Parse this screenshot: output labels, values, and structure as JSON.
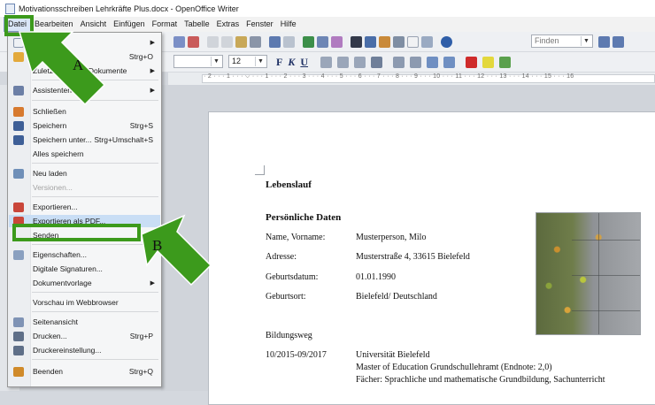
{
  "window": {
    "title": "Motivationsschreiben Lehrkräfte Plus.docx - OpenOffice Writer"
  },
  "menubar": [
    "Datei",
    "Bearbeiten",
    "Ansicht",
    "Einfügen",
    "Format",
    "Tabelle",
    "Extras",
    "Fenster",
    "Hilfe"
  ],
  "toolbar": {
    "search_placeholder": "Finden",
    "font_size": "12",
    "bold": "F",
    "italic": "K",
    "underline": "U"
  },
  "ruler": {
    "ticks": "· 2 · · · 1 · · · ⌵ · · · 1 · · · 2 · · · 3 · · · 4 · · · 5 · · · 6 · · · 7 · · · 8 · · · 9 · · · 10 · · · 11 · · · 12 · · · 13 · · · 14 · · · 15 · · · 16"
  },
  "file_menu": {
    "items": [
      {
        "label": "N",
        "shortcut": "",
        "submenu": true
      },
      {
        "label": "Öffnen...",
        "shortcut": "Strg+O"
      },
      {
        "label": "Zuletzt benutzte Dokumente",
        "shortcut": "",
        "submenu": true
      },
      {
        "label": "Assistenten",
        "shortcut": "",
        "submenu": true
      },
      {
        "label": "Schließen",
        "shortcut": ""
      },
      {
        "label": "Speichern",
        "shortcut": "Strg+S"
      },
      {
        "label": "Speichern unter...",
        "shortcut": "Strg+Umschalt+S"
      },
      {
        "label": "Alles speichern",
        "shortcut": ""
      },
      {
        "label": "Neu laden",
        "shortcut": ""
      },
      {
        "label": "Versionen...",
        "shortcut": ""
      },
      {
        "label": "Exportieren...",
        "shortcut": ""
      },
      {
        "label": "Exportieren als PDF...",
        "shortcut": ""
      },
      {
        "label": "Senden",
        "shortcut": "",
        "submenu": true
      },
      {
        "label": "Eigenschaften...",
        "shortcut": ""
      },
      {
        "label": "Digitale Signaturen...",
        "shortcut": ""
      },
      {
        "label": "Dokumentvorlage",
        "shortcut": "",
        "submenu": true
      },
      {
        "label": "Vorschau im Webbrowser",
        "shortcut": ""
      },
      {
        "label": "Seitenansicht",
        "shortcut": ""
      },
      {
        "label": "Drucken...",
        "shortcut": "Strg+P"
      },
      {
        "label": "Druckereinstellung...",
        "shortcut": ""
      },
      {
        "label": "Beenden",
        "shortcut": "Strg+Q"
      }
    ]
  },
  "annotations": {
    "a": "A",
    "b": "B"
  },
  "document": {
    "title": "Lebenslauf",
    "personal_heading": "Persönliche Daten",
    "rows": [
      {
        "label": "Name, Vorname:",
        "value": "Musterperson, Milo"
      },
      {
        "label": "Adresse:",
        "value": "Musterstraße 4, 33615 Bielefeld"
      },
      {
        "label": "Geburtsdatum:",
        "value": "01.01.1990"
      },
      {
        "label": "Geburtsort:",
        "value": "Bielefeld/ Deutschland"
      }
    ],
    "education_heading": "Bildungsweg",
    "education": {
      "period": "10/2015-09/2017",
      "line1": "Universität Bielefeld",
      "line2": "Master of Education Grundschullehramt (Endnote: 2,0)",
      "line3": "Fächer: Sprachliche und mathematische Grundbildung, Sachunterricht"
    }
  },
  "colors": {
    "highlight_green": "#3c9a1c",
    "menu_hover": "#c9def5",
    "accent_blue": "#1d2f63"
  }
}
